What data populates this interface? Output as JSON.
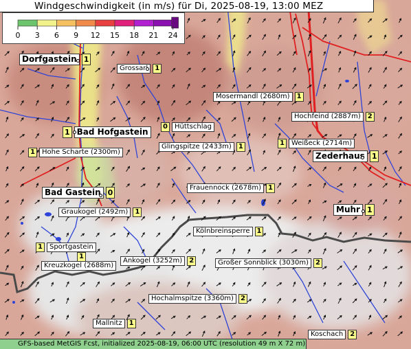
{
  "title": "Windgeschwindigkeit (in m/s) für Di, 2025-08-19, 13:00 MEZ",
  "legend": {
    "ticks": [
      "0",
      "3",
      "6",
      "9",
      "12",
      "15",
      "18",
      "21",
      "24"
    ],
    "colors": [
      "#6cc46c",
      "#f2f28c",
      "#f5c060",
      "#f08a4a",
      "#e84040",
      "#e0207a",
      "#b020d0",
      "#8a10b0",
      "#6a0a80"
    ]
  },
  "footer": "GFS-based MetGIS Fcst, initialized 2025-08-19, 06:00 UTC  (resolution 49 m X 72 m)",
  "places": [
    {
      "name": "Dorfgastein",
      "value": "1",
      "big": true
    },
    {
      "name": "Grossarl",
      "value": "1",
      "big": false
    },
    {
      "name": "Mosermandl (2680m)",
      "value": "1",
      "big": false
    },
    {
      "name": "Hochfeind (2887m)",
      "value": "2",
      "big": false
    },
    {
      "name": "Bad Hofgastein",
      "value": "1",
      "big": true
    },
    {
      "name": "Hüttschlag",
      "value": "0",
      "big": false
    },
    {
      "name": "Hohe Scharte (2300m)",
      "value": "1",
      "big": false
    },
    {
      "name": "Glingspitze (2433m)",
      "value": "1",
      "big": false
    },
    {
      "name": "Weißeck (2714m)",
      "value": "1",
      "big": false
    },
    {
      "name": "Zederhaus",
      "value": "1",
      "big": true
    },
    {
      "name": "Frauennock (2678m)",
      "value": "1",
      "big": false
    },
    {
      "name": "Bad Gastein",
      "value": "0",
      "big": true
    },
    {
      "name": "Graukogel (2492m)",
      "value": "1",
      "big": false
    },
    {
      "name": "Muhr",
      "value": "1",
      "big": true
    },
    {
      "name": "Kölnbreinsperre",
      "value": "1",
      "big": false
    },
    {
      "name": "Sportgastein",
      "value": "1",
      "big": false
    },
    {
      "name": "Kreuzkogel (2688m)",
      "value": "1",
      "big": false
    },
    {
      "name": "Ankogel (3252m)",
      "value": "2",
      "big": false
    },
    {
      "name": "Großer Sonnblick (3030m)",
      "value": "2",
      "big": false
    },
    {
      "name": "Hochalmspitze (3360m)",
      "value": "2",
      "big": false
    },
    {
      "name": "Mallnitz",
      "value": "1",
      "big": false
    },
    {
      "name": "Koschach",
      "value": "2",
      "big": false
    }
  ]
}
